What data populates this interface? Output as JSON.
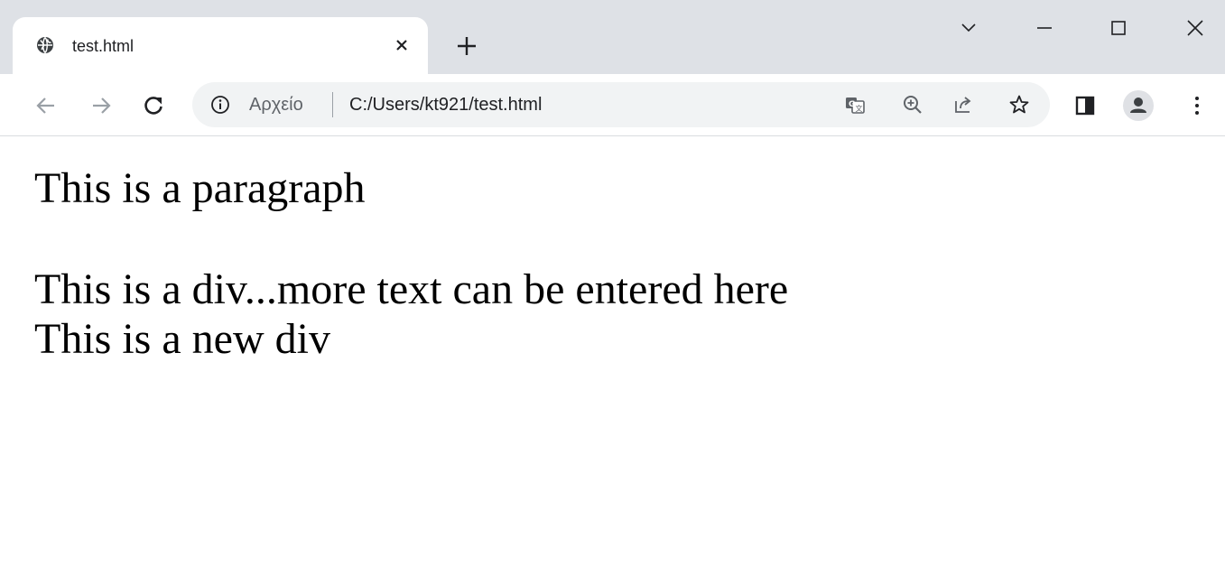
{
  "browser": {
    "tab": {
      "title": "test.html",
      "favicon": "globe-icon",
      "close_symbol": "×"
    },
    "new_tab_icon": "plus-icon",
    "window_controls": [
      "tab-search-icon",
      "minimize-icon",
      "maximize-icon",
      "close-window-icon"
    ],
    "toolbar": {
      "back_icon": "back-arrow-icon",
      "forward_icon": "forward-arrow-icon",
      "reload_icon": "reload-icon"
    },
    "omnibox": {
      "scheme_label": "Αρχείο",
      "url": "C:/Users/kt921/test.html",
      "icons": [
        "translate-icon",
        "zoom-icon",
        "share-icon",
        "bookmark-star-icon"
      ]
    },
    "side_panel_icon": "side-panel-icon",
    "profile_icon": "profile-avatar-icon",
    "menu_icon": "kebab-menu-icon"
  },
  "page": {
    "paragraph": "This is a paragraph",
    "div_text": "This is a div...more text can be entered here",
    "new_div_text": "This is a new div"
  },
  "colors": {
    "tabstrip_bg": "#dee1e6",
    "omnibox_bg": "#f1f3f4",
    "icon_color": "#5f6368",
    "text_color": "#202124"
  }
}
